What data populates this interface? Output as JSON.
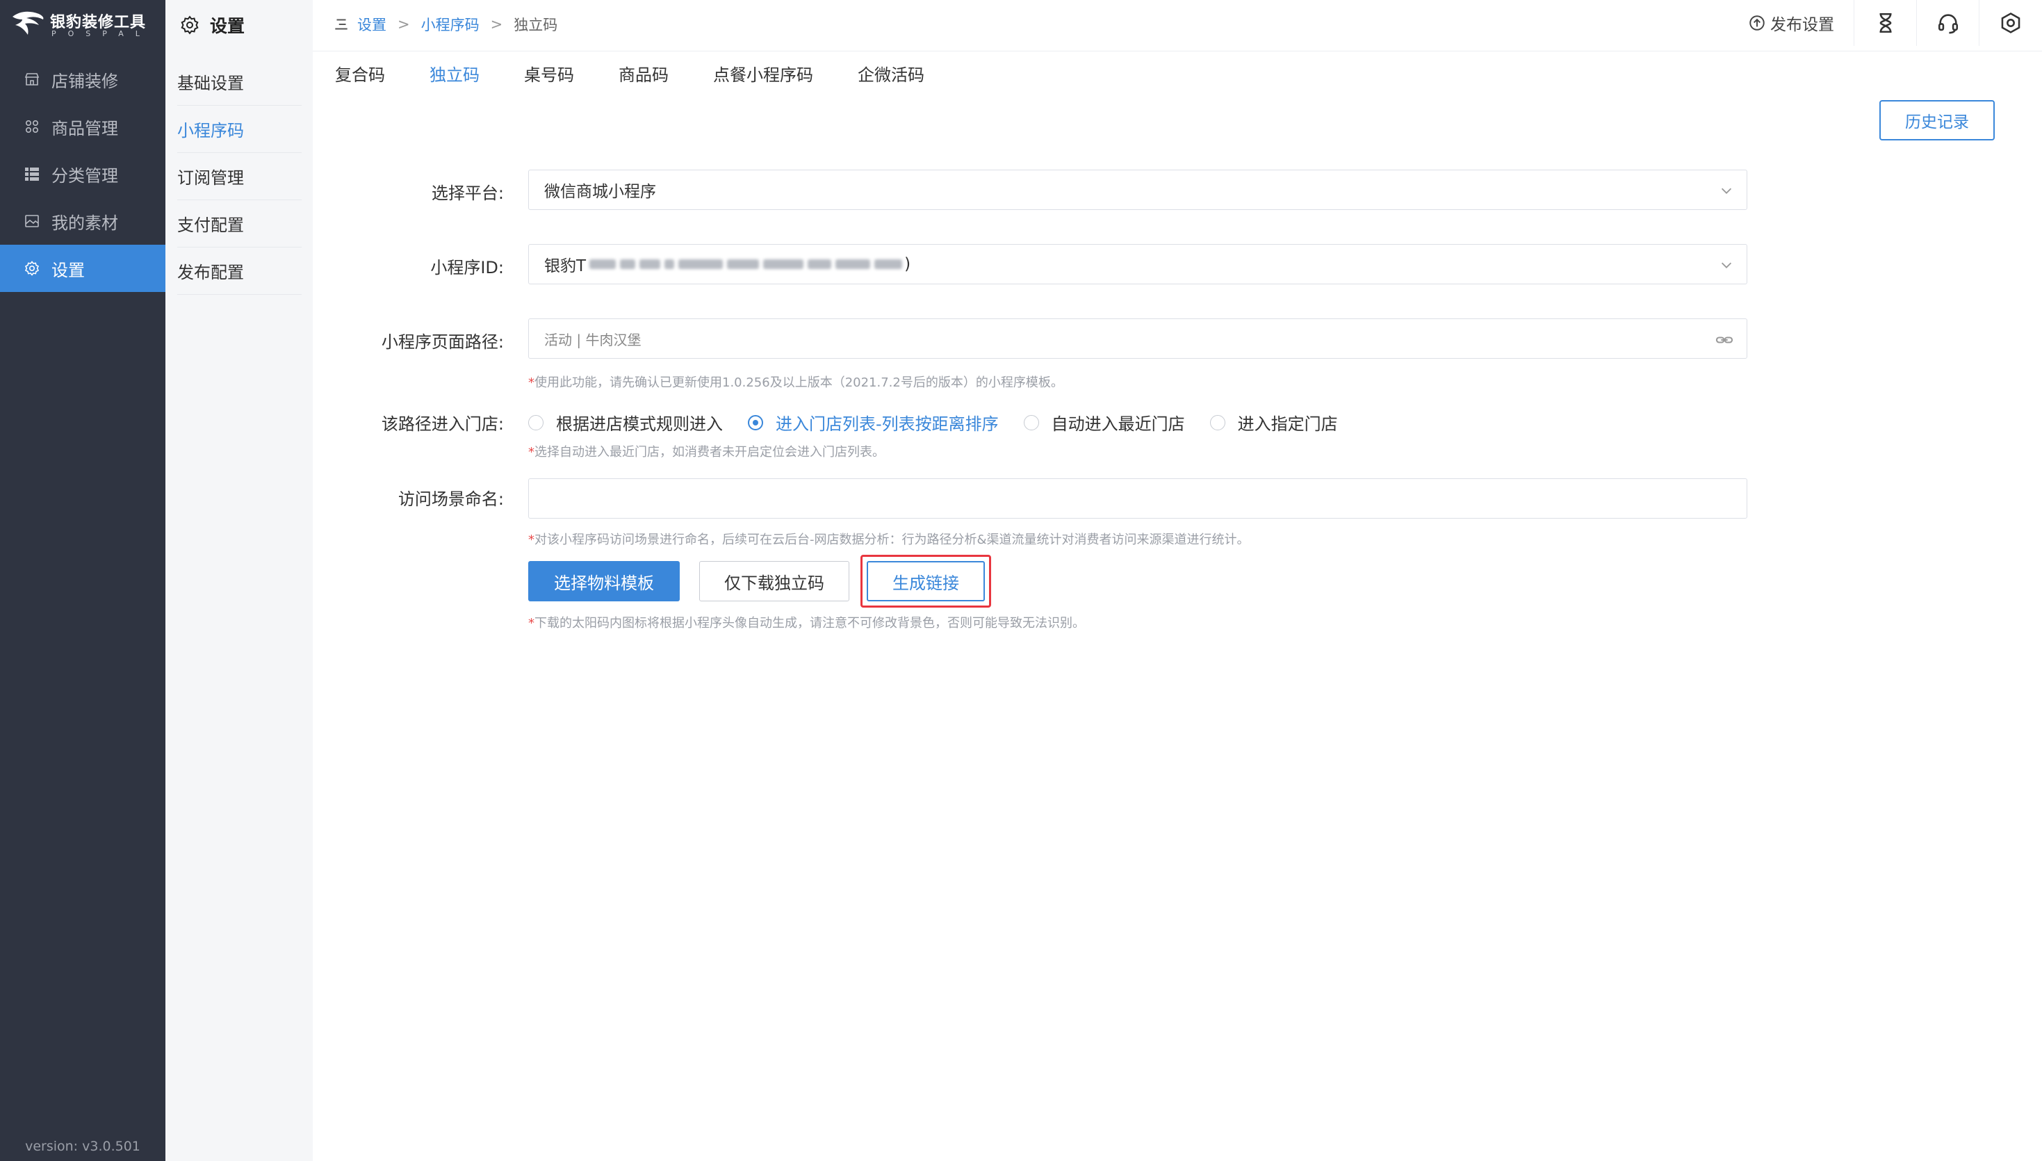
{
  "brand": {
    "name": "银豹装修工具",
    "sub": "POSPAL"
  },
  "sidebar": {
    "items": [
      {
        "label": "店铺装修",
        "icon": "shop-icon"
      },
      {
        "label": "商品管理",
        "icon": "grid-icon"
      },
      {
        "label": "分类管理",
        "icon": "list-icon"
      },
      {
        "label": "我的素材",
        "icon": "image-icon"
      },
      {
        "label": "设置",
        "icon": "gear-icon",
        "active": true
      }
    ],
    "version": "version: v3.0.501"
  },
  "subside": {
    "title": "设置",
    "items": [
      {
        "label": "基础设置"
      },
      {
        "label": "小程序码",
        "active": true
      },
      {
        "label": "订阅管理"
      },
      {
        "label": "支付配置"
      },
      {
        "label": "发布配置"
      }
    ]
  },
  "breadcrumb": {
    "items": [
      "设置",
      "小程序码",
      "独立码"
    ],
    "sep": ">"
  },
  "top_actions": {
    "publish": "发布设置"
  },
  "tabs": [
    "复合码",
    "独立码",
    "桌号码",
    "商品码",
    "点餐小程序码",
    "企微活码"
  ],
  "active_tab": "独立码",
  "history_btn": "历史记录",
  "form": {
    "platform": {
      "label": "选择平台:",
      "value": "微信商城小程序"
    },
    "app_id": {
      "label": "小程序ID:",
      "prefix": "银豹T",
      "suffix": ")"
    },
    "path": {
      "label": "小程序页面路径:",
      "placeholder": "活动 | 牛肉汉堡",
      "hint": "使用此功能，请先确认已更新使用1.0.256及以上版本（2021.7.2号后的版本）的小程序模板。"
    },
    "entry": {
      "label": "该路径进入门店:",
      "options": [
        "根据进店模式规则进入",
        "进入门店列表-列表按距离排序",
        "自动进入最近门店",
        "进入指定门店"
      ],
      "selected_index": 1,
      "hint": "选择自动进入最近门店，如消费者未开启定位会进入门店列表。"
    },
    "scene": {
      "label": "访问场景命名:",
      "value": "",
      "hint": "对该小程序码访问场景进行命名，后续可在云后台-网店数据分析：行为路径分析&渠道流量统计对消费者访问来源渠道进行统计。"
    },
    "buttons": {
      "template": "选择物料模板",
      "download": "仅下载独立码",
      "generate": "生成链接"
    },
    "footer_hint": "下载的太阳码内图标将根据小程序头像自动生成，请注意不可修改背景色，否则可能导致无法识别。"
  },
  "colors": {
    "accent": "#3a87da",
    "sidebar": "#2f3441",
    "highlight": "#e8363f"
  }
}
